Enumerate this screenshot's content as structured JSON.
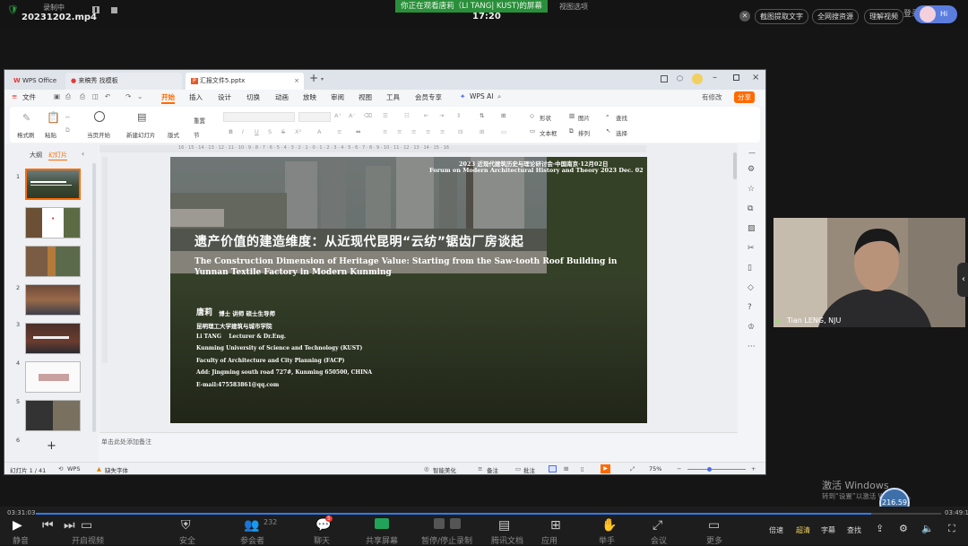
{
  "topbar": {
    "recording_label": "录制中",
    "filename": "20231202.mp4",
    "watching_banner": "你正在观看唐莉（LI TANG| KUST)的屏幕",
    "view_options": "视图选项",
    "time": "17:20",
    "extract_text": "截图提取文字",
    "search_all": "全网搜资源",
    "understand_video": "理解视频",
    "login": "登录",
    "avatar_text": "Hi"
  },
  "wps": {
    "tabs": [
      "WPS Office",
      "来稿秀 找模板",
      "汇报文件5.pptx"
    ],
    "file_menu": "文件",
    "menu_items": [
      "开始",
      "插入",
      "设计",
      "切换",
      "动画",
      "放映",
      "审阅",
      "视图",
      "工具",
      "会员专享",
      "WPS AI"
    ],
    "active_menu": "开始",
    "collab": "有修改",
    "share": "分享",
    "ribbon": {
      "format_painter": "格式刷",
      "paste": "粘贴",
      "start_from_current": "当页开始",
      "new_slide": "新建幻灯片",
      "layout": "版式",
      "section": "节",
      "reset": "重置",
      "shapes": "形状",
      "picture": "图片",
      "find": "查找",
      "textbox": "文本框",
      "arrange": "排列",
      "select": "选择"
    },
    "panel_tabs": [
      "大纲",
      "幻灯片"
    ],
    "slide_numbers": [
      "1",
      "2",
      "3",
      "4",
      "5",
      "6",
      "7"
    ],
    "add_slide_symbol": "+",
    "notes_placeholder": "单击此处添加备注",
    "status": {
      "slide_count": "幻灯片 1 / 41",
      "wps": "WPS",
      "missing_font": "缺失字体",
      "smart_beautify": "智能美化",
      "notes": "备注",
      "comments": "批注",
      "zoom": "75%"
    },
    "ruler_numbers": [
      "16",
      "15",
      "14",
      "13",
      "12",
      "11",
      "10",
      "9",
      "8",
      "7",
      "6",
      "5",
      "4",
      "3",
      "2",
      "1",
      "0",
      "1",
      "2",
      "3",
      "4",
      "5",
      "6",
      "7",
      "8",
      "9",
      "10",
      "11",
      "12",
      "13",
      "14",
      "15",
      "16"
    ]
  },
  "slide": {
    "forum_cn": "2023 近现代建筑历史与理论研讨会·中国南京·12月02日",
    "forum_en": "Forum on Modern Architectural History and Theory 2023 Dec. 02",
    "title_cn": "遗产价值的建造维度：从近现代昆明“云纺”锯齿厂房谈起",
    "title_en": "The Construction Dimension of Heritage Value: Starting from the Saw-tooth Roof Building in Yunnan Textile Factory in Modern Kunming",
    "author_cn": "唐莉",
    "author_cn_titles": "博士 讲师 硕士生导师",
    "school_cn": "昆明理工大学建筑与城市学院",
    "author_en": "Li TANG    Lecturer & Dr.Eng.",
    "univ_en": "Kunming University of Science and Technology (KUST)",
    "faculty_en": "Faculty of Architecture and City Planning  (FACP)",
    "address": "Add: Jingming south road 727#, Kunming 650500,  CHINA",
    "email": "E-mail:475583861@qq.com"
  },
  "webcam": {
    "name": "Tian LENG, NJU"
  },
  "windows_watermark": {
    "line1": "激活 Windows",
    "line2": "转到“设置”以激活 Windows。"
  },
  "bottombar": {
    "time_elapsed": "03:31:03",
    "time_total": "03:49:17",
    "progress": 0.923,
    "participants": "232",
    "chat_badge": "5",
    "items": [
      "静音",
      "开启视频",
      "安全",
      "参会者",
      "聊天",
      "共享屏幕",
      "暂停/停止录制",
      "腾讯文档",
      "应用",
      "举手",
      "会议",
      "更多"
    ],
    "speed": "倍速",
    "hd": "超清",
    "subtitle": "字幕",
    "search": "查找",
    "badge_text": "216.59"
  },
  "colors": {
    "accent_orange": "#ff6a00",
    "wps_red": "#e53935",
    "share_green": "#21a35a",
    "title_white": "#ffffff",
    "yellow_text": "#f3d25a"
  }
}
